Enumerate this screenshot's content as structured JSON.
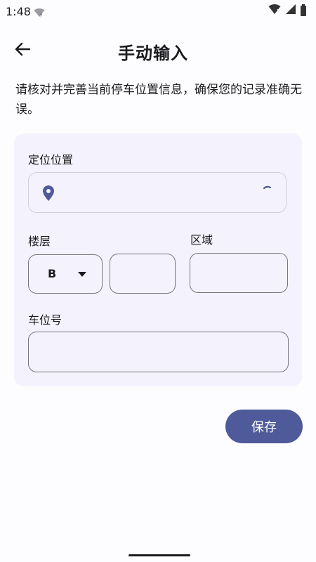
{
  "status_bar": {
    "time": "1:48",
    "wifi_small_mark": "?",
    "icons": [
      "wifi-icon",
      "signal-icon",
      "battery-icon"
    ]
  },
  "app_bar": {
    "back_icon": "arrow-left-icon",
    "title": "手动输入"
  },
  "instruction": "请核对并完善当前停车位置信息，确保您的记录准确无误。",
  "form": {
    "location": {
      "label": "定位位置",
      "value": "",
      "icon": "location-pin-icon",
      "loading": true
    },
    "floor": {
      "label": "楼层",
      "prefix_selected": "B",
      "number_value": ""
    },
    "area": {
      "label": "区域",
      "value": ""
    },
    "space": {
      "label": "车位号",
      "value": ""
    }
  },
  "save_button": {
    "label": "保存"
  },
  "colors": {
    "accent": "#4e5a99",
    "card_bg": "#f4f3fd",
    "page_bg": "#fdfcff",
    "pin": "#4e5a99"
  }
}
